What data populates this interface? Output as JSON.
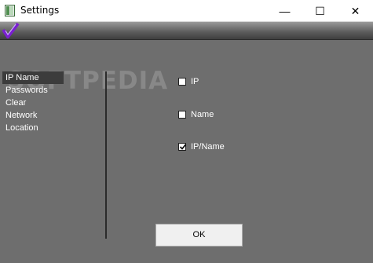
{
  "window": {
    "title": "Settings",
    "minimize_symbol": "—",
    "maximize_symbol": "☐",
    "close_symbol": "✕"
  },
  "sidebar": {
    "items": [
      {
        "label": "IP Name",
        "selected": true
      },
      {
        "label": "Passwords",
        "selected": false
      },
      {
        "label": "Clear",
        "selected": false
      },
      {
        "label": "Network",
        "selected": false
      },
      {
        "label": "Location",
        "selected": false
      }
    ]
  },
  "watermark": "SOFTPEDIA",
  "options": [
    {
      "label": "IP",
      "checked": false
    },
    {
      "label": "Name",
      "checked": false
    },
    {
      "label": "IP/Name",
      "checked": true
    }
  ],
  "ok_button": {
    "label": "OK"
  },
  "colors": {
    "background": "#6e6e6e",
    "logo_accent": "#7a1fd0",
    "selected_item": "#3c3c3c"
  },
  "icons": {
    "app": "app-window-icon",
    "logo": "checkmark-logo-icon"
  }
}
